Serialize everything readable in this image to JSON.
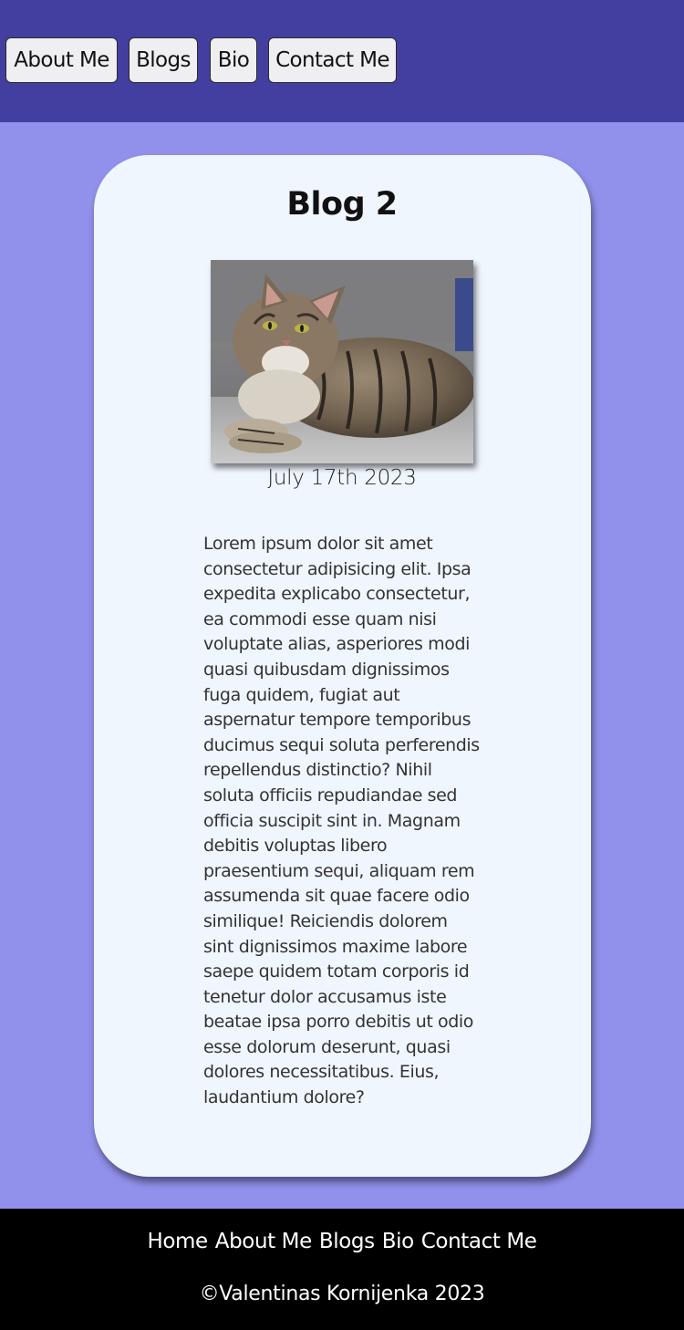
{
  "nav": {
    "buttons": [
      "About Me",
      "Blogs",
      "Bio",
      "Contact Me"
    ]
  },
  "article": {
    "title": "Blog 2",
    "image_alt": "tabby cat lying on a grey couch",
    "date": "July 17th 2023",
    "body": "Lorem ipsum dolor sit amet consectetur adipisicing elit. Ipsa expedita explicabo consectetur, ea commodi esse quam nisi voluptate alias, asperiores modi quasi quibusdam dignissimos fuga quidem, fugiat aut aspernatur tempore temporibus ducimus sequi soluta perferendis repellendus distinctio? Nihil soluta officiis repudiandae sed officia suscipit sint in. Magnam debitis voluptas libero praesentium sequi, aliquam rem assumenda sit quae facere odio similique! Reiciendis dolorem sint dignissimos maxime labore saepe quidem totam corporis id tenetur dolor accusamus iste beatae ipsa porro debitis ut odio esse dolorum deserunt, quasi dolores necessitatibus. Eius, laudantium dolore?"
  },
  "footer": {
    "links": [
      "Home",
      "About Me",
      "Blogs",
      "Bio",
      "Contact Me"
    ],
    "copyright": "©Valentinas Kornijenka 2023"
  },
  "colors": {
    "header_bg": "#433fa0",
    "page_bg": "#9191eb",
    "card_bg": "#f0f6fe",
    "footer_bg": "#000000"
  }
}
